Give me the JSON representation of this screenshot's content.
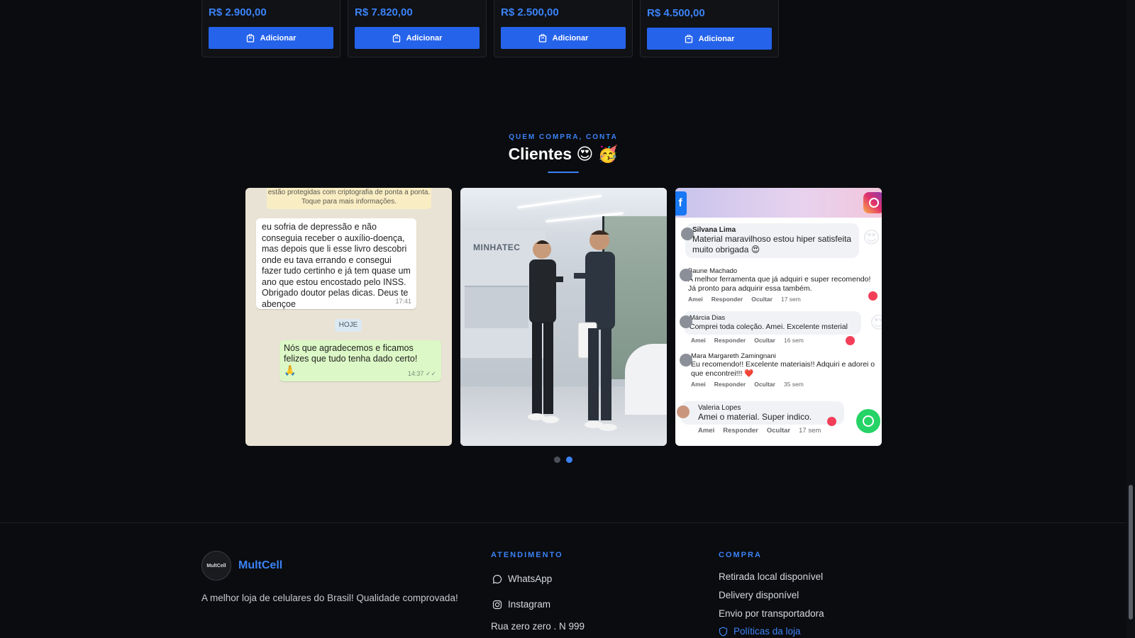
{
  "products": [
    {
      "price": "R$ 2.900,00",
      "button": "Adicionar"
    },
    {
      "price": "R$ 7.820,00",
      "button": "Adicionar"
    },
    {
      "price": "R$ 2.500,00",
      "button": "Adicionar"
    },
    {
      "price": "R$ 4.500,00",
      "button": "Adicionar"
    }
  ],
  "section": {
    "eyebrow": "QUEM COMPRA, CONTA",
    "title": "Clientes 😍 🥳"
  },
  "slides": {
    "whatsapp": {
      "notice": "estão protegidas com criptografia de ponta a ponta. Toque para mais informações.",
      "incoming": "eu sofria de depressão e não conseguia receber o auxílio-doença, mas depois que li esse livro descobri onde eu tava errando e consegui fazer tudo certinho e já tem quase um ano que estou encostado pelo INSS. Obrigado doutor pelas dicas. Deus te abençoe",
      "incoming_time": "17:41",
      "day": "HOJE",
      "outgoing": "Nós que agradecemos e ficamos felizes que tudo tenha dado certo!",
      "outgoing_emoji": "🙏",
      "outgoing_time": "14:37 ✓✓"
    },
    "store": {
      "brand": "MINHATEC"
    },
    "comments": {
      "fb_icon": "f",
      "items": [
        {
          "name": "Silvana Lima",
          "text": "Material maravilhoso estou hiper satisfeita muito obrigada 😍",
          "acts": [
            "",
            "",
            ""
          ],
          "when": ""
        },
        {
          "name": "Baune Machado",
          "text": "A melhor ferramenta que já adquiri e super recomendo! Já pronto para adquirir essa também.",
          "acts": [
            "Amei",
            "Responder",
            "Ocultar"
          ],
          "when": "17 sem"
        },
        {
          "name": "Márcia Dias",
          "text": "Comprei toda coleção. Amei. Excelente msterial",
          "acts": [
            "Amei",
            "Responder",
            "Ocultar"
          ],
          "when": "16 sem"
        },
        {
          "name": "Mara Margareth Zamingnani",
          "text": "Eu recomendo!! Excelente materiais!! Adquiri e adorei o que encontrei!!! ❤️",
          "acts": [
            "Amei",
            "Responder",
            "Ocultar"
          ],
          "when": "35 sem"
        },
        {
          "name": "Valeria Lopes",
          "text": "Amei o material. Super indico.",
          "acts": [
            "Amei",
            "Responder",
            "Ocultar"
          ],
          "when": "17 sem"
        }
      ]
    }
  },
  "carousel": {
    "active_index": 1,
    "count": 2
  },
  "footer": {
    "brand": "MultCell",
    "logo_text": "MultCell",
    "tagline": "A melhor loja de celulares do Brasil! Qualidade comprovada!",
    "atendimento": {
      "title": "ATENDIMENTO",
      "whatsapp": "WhatsApp",
      "instagram": "Instagram",
      "address": "Rua zero zero . N 999"
    },
    "compra": {
      "title": "COMPRA",
      "items": [
        "Retirada local disponível",
        "Delivery disponível",
        "Envio por transportadora"
      ],
      "policies": "Políticas da loja"
    }
  },
  "colors": {
    "accent": "#3b82f6",
    "button": "#2563eb",
    "background": "#0b0c0f"
  }
}
